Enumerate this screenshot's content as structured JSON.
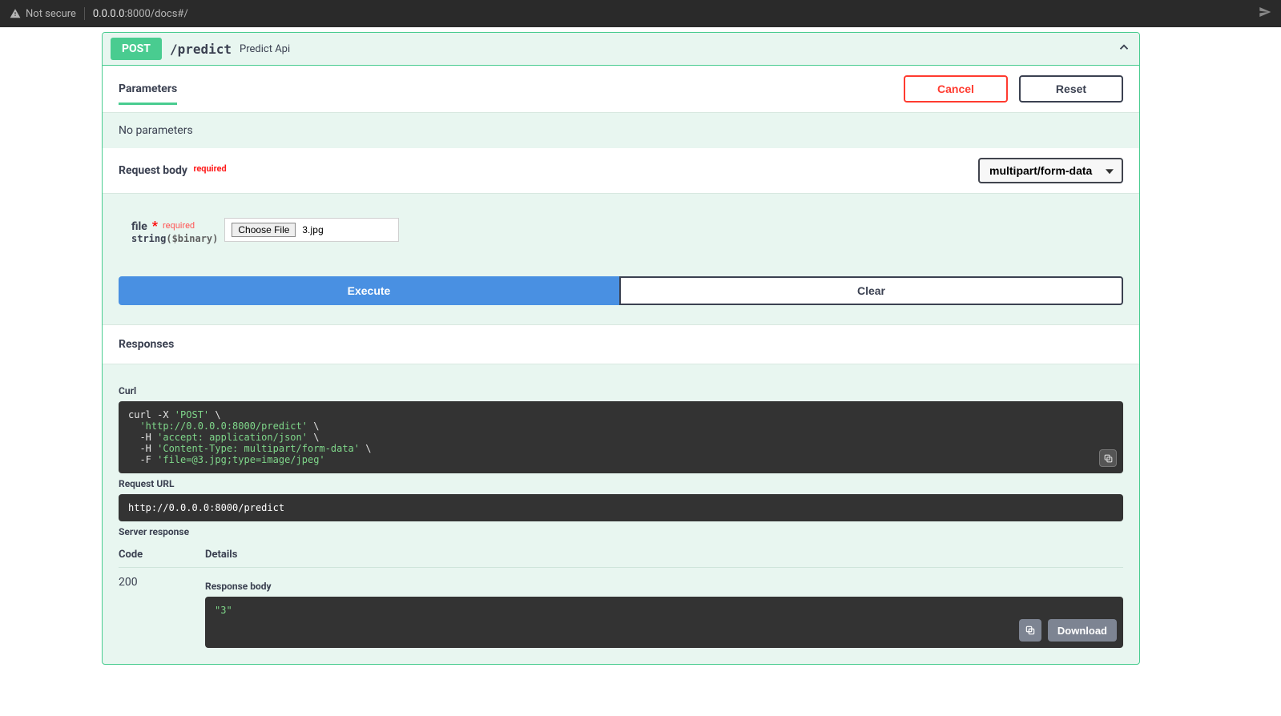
{
  "urlbar": {
    "insecure_label": "Not secure",
    "host": "0.0.0.0",
    "port_path": ":8000/docs#/"
  },
  "op": {
    "method": "POST",
    "path": "/predict",
    "summary": "Predict Api"
  },
  "parameters": {
    "tab_label": "Parameters",
    "cancel_label": "Cancel",
    "reset_label": "Reset",
    "no_params": "No parameters"
  },
  "request_body": {
    "header": "Request body",
    "required_tag": "required",
    "content_type": "multipart/form-data",
    "param_name": "file",
    "param_required": "required",
    "param_type": "string",
    "param_format": "($binary)",
    "choose_file_label": "Choose File",
    "selected_filename": "3.jpg"
  },
  "actions": {
    "execute": "Execute",
    "clear": "Clear"
  },
  "responses": {
    "header": "Responses",
    "curl_label": "Curl",
    "curl_lines": {
      "l1a": "curl -X ",
      "l1b": "'POST'",
      "l1c": " \\",
      "l2a": "  ",
      "l2b": "'http://0.0.0.0:8000/predict'",
      "l2c": " \\",
      "l3a": "  -H ",
      "l3b": "'accept: application/json'",
      "l3c": " \\",
      "l4a": "  -H ",
      "l4b": "'Content-Type: multipart/form-data'",
      "l4c": " \\",
      "l5a": "  -F ",
      "l5b": "'file=@3.jpg;type=image/jpeg'"
    },
    "request_url_label": "Request URL",
    "request_url": "http://0.0.0.0:8000/predict",
    "server_response_label": "Server response",
    "code_header": "Code",
    "details_header": "Details",
    "code": "200",
    "response_body_label": "Response body",
    "response_body": "\"3\"",
    "download_label": "Download"
  }
}
